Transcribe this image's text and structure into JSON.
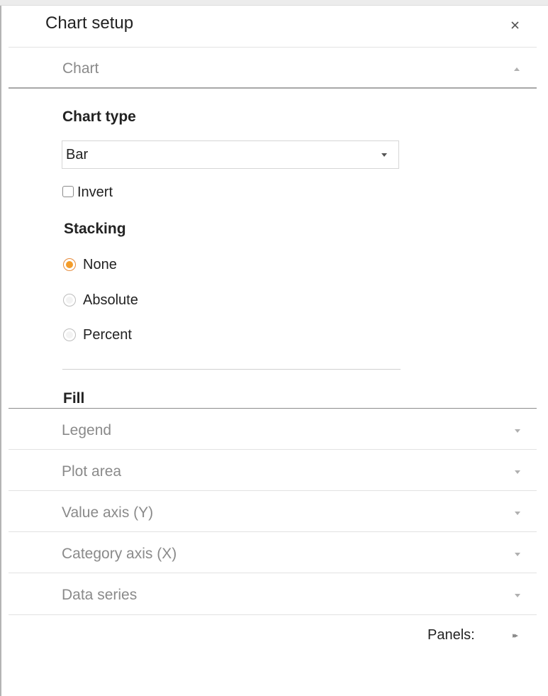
{
  "header": {
    "title": "Chart setup",
    "close_icon": "close-icon"
  },
  "chart_section": {
    "label": "Chart",
    "chart_type": {
      "heading": "Chart type",
      "selected": "Bar"
    },
    "invert": {
      "label": "Invert",
      "checked": false
    },
    "stacking": {
      "heading": "Stacking",
      "options": [
        {
          "label": "None",
          "selected": true
        },
        {
          "label": "Absolute",
          "selected": false
        },
        {
          "label": "Percent",
          "selected": false
        }
      ]
    },
    "fill": {
      "heading": "Fill"
    }
  },
  "sections": [
    {
      "label": "Legend"
    },
    {
      "label": "Plot area"
    },
    {
      "label": "Value axis (Y)"
    },
    {
      "label": "Category axis (X)"
    },
    {
      "label": "Data series"
    }
  ],
  "footer": {
    "panels_label": "Panels:",
    "panels_icon": "double-chevron-right-icon"
  },
  "colors": {
    "accent": "#f39c2a",
    "muted_text": "#8a8a8a",
    "text": "#222222"
  }
}
